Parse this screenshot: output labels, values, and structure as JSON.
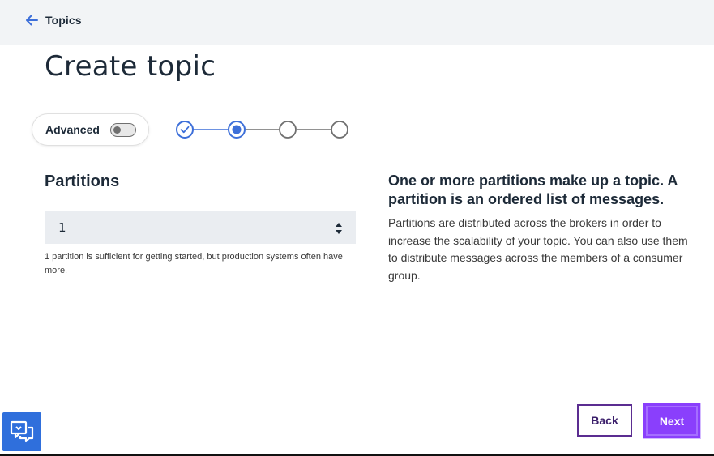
{
  "header": {
    "back_label": "Topics",
    "background": "#f2f4f6"
  },
  "page": {
    "title": "Create topic"
  },
  "advanced": {
    "label": "Advanced",
    "enabled": false
  },
  "stepper": {
    "total_steps": 4,
    "current_step": 2,
    "completed_steps": 1,
    "color": "#3d6fd9"
  },
  "partitions": {
    "title": "Partitions",
    "value": "1",
    "helper": "1 partition is sufficient for getting started, but production systems often have more."
  },
  "info": {
    "heading": "One or more partitions make up a topic. A partition is an ordered list of messages.",
    "body": "Partitions are distributed across the brokers in order to increase the scalability of your topic. You can also use them to distribute messages across the members of a consumer group."
  },
  "actions": {
    "back_label": "Back",
    "next_label": "Next",
    "primary_color": "#8a3ffc"
  },
  "icons": {
    "back": "arrow-left-icon",
    "spin": "caret-sort-icon",
    "chat": "chat-bubbles-icon",
    "check": "checkmark-icon"
  }
}
